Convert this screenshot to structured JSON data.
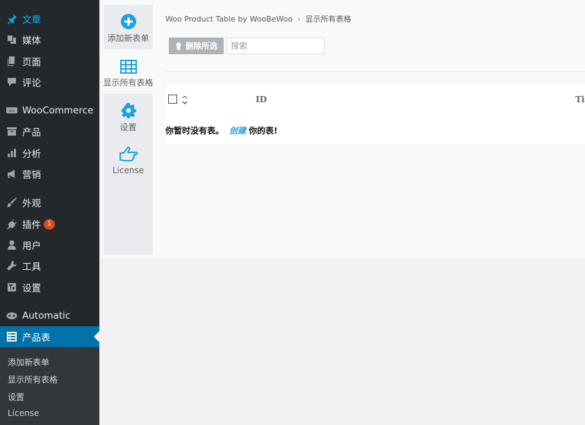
{
  "sidebar": {
    "items": [
      {
        "label": "文章",
        "icon": "pushpin-icon"
      },
      {
        "label": "媒体",
        "icon": "media-icon"
      },
      {
        "label": "页面",
        "icon": "page-icon"
      },
      {
        "label": "评论",
        "icon": "comment-icon"
      },
      {
        "label": "WooCommerce",
        "icon": "woo-icon"
      },
      {
        "label": "产品",
        "icon": "archive-icon"
      },
      {
        "label": "分析",
        "icon": "bar-chart-icon"
      },
      {
        "label": "营销",
        "icon": "megaphone-icon"
      },
      {
        "label": "外观",
        "icon": "brush-icon"
      },
      {
        "label": "插件",
        "icon": "plugin-icon",
        "badge": "1"
      },
      {
        "label": "用户",
        "icon": "user-icon"
      },
      {
        "label": "工具",
        "icon": "wrench-icon"
      },
      {
        "label": "设置",
        "icon": "settings-sliders-icon"
      },
      {
        "label": "Automatic",
        "icon": "robot-icon"
      },
      {
        "label": "产品表",
        "icon": "table-list-icon"
      }
    ],
    "submenu": [
      "添加新表单",
      "显示所有表格",
      "设置",
      "License"
    ]
  },
  "tabs": [
    {
      "label": "添加新表单",
      "icon": "plus-circle-icon"
    },
    {
      "label": "显示所有表格",
      "icon": "table-grid-icon"
    },
    {
      "label": "设置",
      "icon": "gear-icon"
    },
    {
      "label": "License",
      "icon": "hand-pointer-icon"
    }
  ],
  "breadcrumb": {
    "root": "Woo Product Table by WooBeWoo",
    "current": "显示所有表格"
  },
  "toolbar": {
    "delete_label": "删除所选",
    "search_placeholder": "搜索"
  },
  "table": {
    "columns": [
      "ID",
      "Tit"
    ]
  },
  "empty": {
    "prefix": "你暂时没有表。",
    "link": "创建",
    "suffix": "你的表!"
  },
  "colors": {
    "sidebar": "#23282d",
    "current": "#0073aa",
    "accent": "#1aa3e0",
    "badge": "#d54e21"
  }
}
